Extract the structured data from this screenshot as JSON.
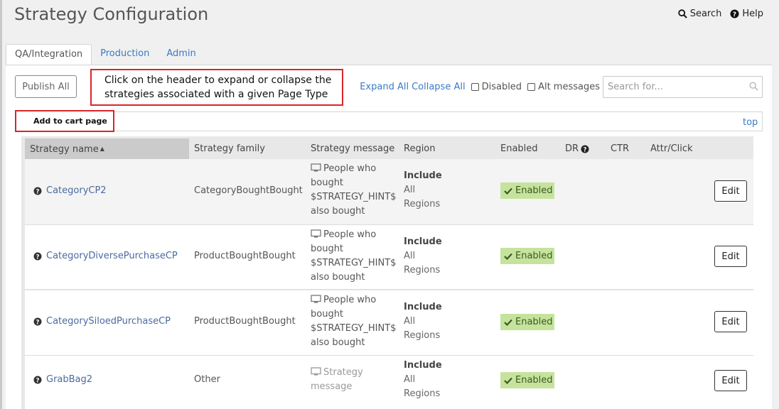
{
  "page": {
    "title": "Strategy Configuration"
  },
  "top_links": {
    "search": "Search",
    "help": "Help"
  },
  "tabs": [
    {
      "label": "QA/Integration",
      "active": true
    },
    {
      "label": "Production",
      "active": false
    },
    {
      "label": "Admin",
      "active": false
    }
  ],
  "toolbar": {
    "publish_all": "Publish All",
    "expand_all": "Expand All",
    "collapse_all": "Collapse All",
    "disabled_label": "Disabled",
    "alt_messages_label": "Alt messages",
    "search_placeholder": "Search for..."
  },
  "callout": {
    "line1": "Click on the header to expand or collapse the",
    "line2": "strategies associated with a given Page Type"
  },
  "section": {
    "title": "Add to cart page",
    "top_link": "top"
  },
  "table": {
    "headers": {
      "name": "Strategy name",
      "family": "Strategy family",
      "message": "Strategy message",
      "region": "Region",
      "enabled": "Enabled",
      "dr": "DR",
      "ctr": "CTR",
      "attr": "Attr/Click"
    },
    "rows": [
      {
        "name": "CategoryCP2",
        "family": "CategoryBoughtBought",
        "message": [
          "People who",
          "bought",
          "$STRATEGY_HINT$",
          "also bought"
        ],
        "region_label": "Include",
        "region_value": [
          "All",
          "Regions"
        ],
        "status": "Enabled",
        "edit": "Edit"
      },
      {
        "name": "CategoryDiversePurchaseCP",
        "family": "ProductBoughtBought",
        "message": [
          "People who",
          "bought",
          "$STRATEGY_HINT$",
          "also bought"
        ],
        "region_label": "Include",
        "region_value": [
          "All",
          "Regions"
        ],
        "status": "Enabled",
        "edit": "Edit"
      },
      {
        "name": "CategorySiloedPurchaseCP",
        "family": "ProductBoughtBought",
        "message": [
          "People who",
          "bought",
          "$STRATEGY_HINT$",
          "also bought"
        ],
        "region_label": "Include",
        "region_value": [
          "All",
          "Regions"
        ],
        "status": "Enabled",
        "edit": "Edit"
      },
      {
        "name": "GrabBag2",
        "family": "Other",
        "message": [
          "Strategy",
          "message"
        ],
        "region_label": "Include",
        "region_value": [
          "All",
          "Regions"
        ],
        "status": "Enabled",
        "edit": "Edit"
      }
    ]
  },
  "colors": {
    "link": "#3a7ac7",
    "callout_border": "#d9262a",
    "enabled_badge": "#c6e39d"
  },
  "icons": {
    "search": "search-icon",
    "help": "help-circle-icon",
    "monitor": "monitor-icon",
    "check": "check-icon",
    "sort": "sort-asc-icon",
    "info": "question-circle-icon"
  }
}
